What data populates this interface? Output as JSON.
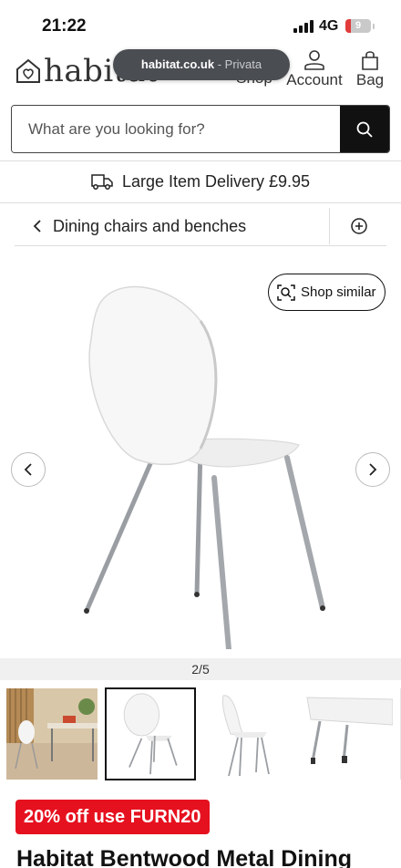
{
  "status_bar": {
    "time": "21:22",
    "network": "4G",
    "battery": "9"
  },
  "header": {
    "logo_text": "habitat",
    "nav": {
      "shop": "Shop",
      "account": "Account",
      "bag": "Bag"
    },
    "url_pill": {
      "host": "habitat.co.uk",
      "mode": "- Privata"
    }
  },
  "search": {
    "placeholder": "What are you looking for?"
  },
  "delivery": {
    "text": "Large Item Delivery £9.95"
  },
  "breadcrumb": {
    "label": "Dining chairs and benches"
  },
  "gallery": {
    "shop_similar": "Shop similar",
    "pager": "2/5",
    "current_index": 2,
    "total": 5
  },
  "promo": {
    "text": "20% off use FURN20"
  },
  "product": {
    "title": "Habitat Bentwood Metal Dining"
  },
  "colors": {
    "promo_red": "#e6111f",
    "search_button": "#111111",
    "pill_bg": "#4a4d52"
  }
}
